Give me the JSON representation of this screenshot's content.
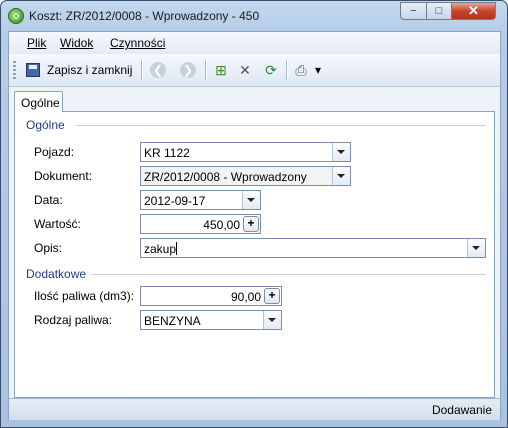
{
  "window": {
    "title": "Koszt: ZR/2012/0008 - Wprowadzony - 450",
    "controls": {
      "minimize": "−",
      "maximize": "□",
      "close": "✕"
    }
  },
  "menu": {
    "items": [
      {
        "label": "Plik"
      },
      {
        "label": "Widok"
      },
      {
        "label": "Czynności"
      }
    ]
  },
  "toolbar": {
    "save_label": "Zapisz i zamknij",
    "icons": [
      "save-icon",
      "back-icon",
      "forward-icon",
      "properties-icon",
      "tools-icon",
      "refresh-icon",
      "print-icon",
      "dropdown-arrow-icon"
    ],
    "back_glyph": "❮",
    "forward_glyph": "❯",
    "properties_glyph": "⊞",
    "tools_glyph": "✕",
    "refresh_glyph": "⟳",
    "print_glyph": "⎙",
    "arrow_glyph": "▾"
  },
  "tabs": [
    {
      "label": "Ogólne",
      "active": true
    }
  ],
  "groups": {
    "general": {
      "title": "Ogólne",
      "vehicle": {
        "label": "Pojazd:",
        "value": "KR 1122"
      },
      "document": {
        "label": "Dokument:",
        "value": "ZR/2012/0008 - Wprowadzony"
      },
      "date": {
        "label": "Data:",
        "value": "2012-09-17"
      },
      "amount": {
        "label": "Wartość:",
        "value": "450,00"
      },
      "description": {
        "label": "Opis:",
        "value": "zakup"
      }
    },
    "additional": {
      "title": "Dodatkowe",
      "fuel_amount": {
        "label": "Ilość paliwa (dm3):",
        "value": "90,00"
      },
      "fuel_type": {
        "label": "Rodzaj paliwa:",
        "value": "BENZYNA"
      }
    }
  },
  "status": {
    "text": "Dodawanie"
  },
  "colors": {
    "accent": "#1f3c88",
    "close": "#c8442a"
  }
}
